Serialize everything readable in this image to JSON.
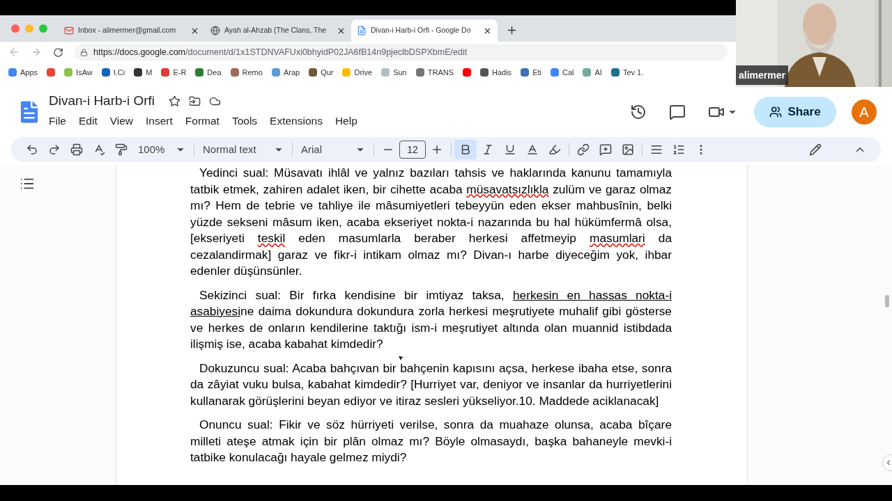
{
  "browser": {
    "tabs": [
      {
        "kind": "gmail",
        "title": "Inbox - alimermer@gmail.com",
        "selected": false
      },
      {
        "kind": "globe",
        "title": "Ayah al-Ahzab (The Clans, The",
        "selected": false
      },
      {
        "kind": "docs",
        "title": "Divan-i Harb-i Orfi - Google Do",
        "selected": true
      }
    ],
    "url_host": "https://docs.google.com",
    "url_path": "/document/d/1x1STDNVAFUxi0bhyidP02JA6fB14n9pjeclbDSPXbmE/edit",
    "bookmarks": [
      {
        "label": "Apps",
        "color": "#4285f4"
      },
      {
        "color": "#ea4335"
      },
      {
        "label": "IsAw",
        "color": "#8bc34a"
      },
      {
        "label": "I.Ci",
        "color": "#1565c0"
      },
      {
        "label": "M",
        "color": "#333333"
      },
      {
        "label": "E-R",
        "color": "#e53935"
      },
      {
        "label": "Dea",
        "color": "#2e7d32"
      },
      {
        "label": "Remo",
        "color": "#9e6b5a"
      },
      {
        "label": "Arap",
        "color": "#5b9bd5"
      },
      {
        "label": "Qur",
        "color": "#6d5a3a"
      },
      {
        "label": "Drive",
        "color": "#fbbc04"
      },
      {
        "label": "Sun",
        "color": "#b0bec5"
      },
      {
        "label": "TRANS",
        "color": "#757575"
      },
      {
        "color": "#ff0000"
      },
      {
        "label": "Hadis",
        "color": "#555555"
      },
      {
        "label": "Eti",
        "color": "#3f6fb5"
      },
      {
        "label": "Cal",
        "color": "#4285f4"
      },
      {
        "label": "AI",
        "color": "#74aa9c"
      },
      {
        "label": "Tev 1.",
        "color": "#1e6f8c"
      }
    ]
  },
  "video": {
    "name": "alimermer"
  },
  "doc": {
    "title": "Divan-i Harb-i Orfi",
    "menu": [
      "File",
      "Edit",
      "View",
      "Insert",
      "Format",
      "Tools",
      "Extensions",
      "Help"
    ],
    "share": "Share",
    "avatar": "A",
    "zoom": "100%",
    "style": "Normal text",
    "font": "Arial",
    "size": "12",
    "format_buttons": [
      {
        "kind": "bold",
        "selected": true
      },
      {
        "kind": "italic",
        "selected": false
      },
      {
        "kind": "underline",
        "selected": false
      }
    ],
    "paragraphs": [
      {
        "segments": [
          {
            "text": "Yedinci sual: Müsavatı ihlâl ve yalnız bazıları tahsis ve haklarında kanunu tamamıyla tatbik etmek, zahiren adalet iken, bir cihette acaba "
          },
          {
            "text": "müsavatsızlıkla",
            "kind": "misspelled"
          },
          {
            "text": " zulüm ve garaz olmaz mı? Hem de tebrie ve tahliye ile mâsumiyetleri tebeyyün eden ekser mahbusînin, belki yüzde sekseni mâsum iken, acaba ekseriyet nokta-i nazarında bu hal hükümfermâ olsa, [ekseriyeti "
          },
          {
            "text": "teskil",
            "kind": "misspelled"
          },
          {
            "text": " eden masumlarla beraber herkesi affetmeyip "
          },
          {
            "text": "masumlari",
            "kind": "misspelled"
          },
          {
            "text": " da cezalandirmak] garaz ve fikr-i intikam olmaz mı? Divan-ı harbe diyeceğim yok, ihbar edenler düşünsünler."
          }
        ]
      },
      {
        "segments": [
          {
            "text": "Sekizinci sual: Bir fırka kendisine bir imtiyaz taksa, "
          },
          {
            "text": "herkesin en hassas nokta-i asabiyesi",
            "kind": "underline"
          },
          {
            "text": "ne daima dokundura dokundura zorla herkesi meşrutiyete muhalif gibi gösterse ve herkes de onların kendilerine taktığı ism-i meşrutiyet altında olan muannid istibdada ilişmiş ise, acaba kabahat kimdedir?"
          }
        ]
      },
      {
        "segments": [
          {
            "text": "Dokuzuncu sual: Acaba bahçıvan bir bahçenin kapısını açsa, herkese ibaha etse, sonra da zâyiat vuku bulsa, kabahat kimdedir? [Hurriyet var, deniyor ve insanlar da hurriyetlerini kullanarak görüşlerini beyan ediyor ve itiraz sesleri yükseliyor.10. Maddede aciklanacak]"
          }
        ]
      },
      {
        "segments": [
          {
            "text": "Onuncu sual: Fikir ve söz hürriyeti verilse, sonra da muahaze olunsa, acaba bîçare milleti ateşe atmak için bir plân olmaz mı? Böyle olmasaydı, başka bahaneyle mevki-i tatbike konulacağı hayale gelmez miydi?"
          }
        ]
      }
    ]
  }
}
